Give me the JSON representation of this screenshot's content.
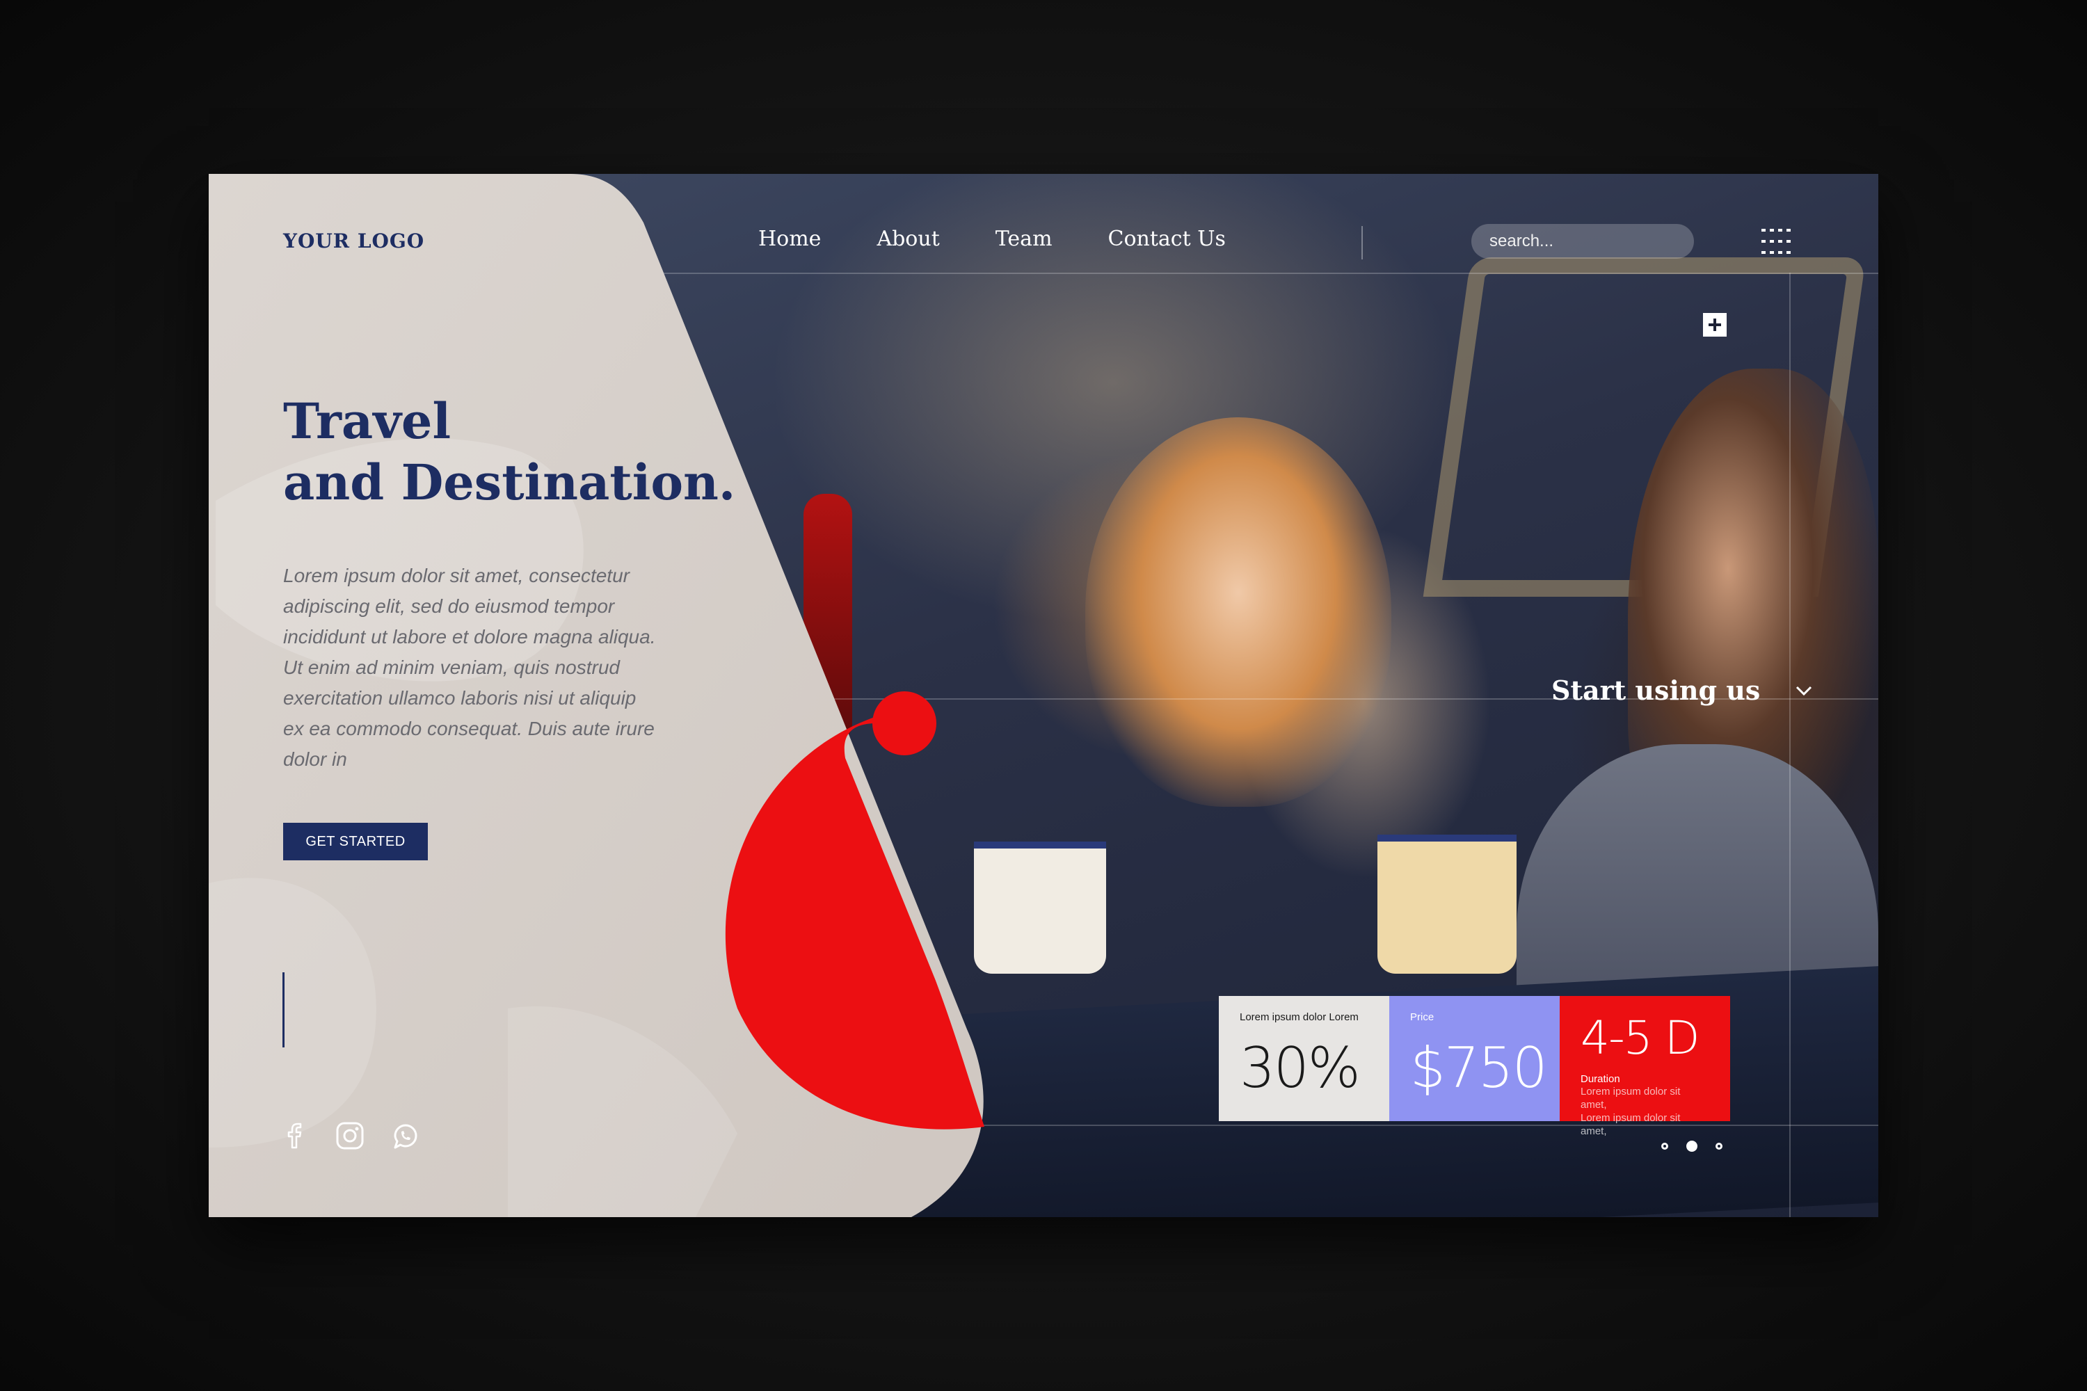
{
  "logo": "YOUR LOGO",
  "nav": {
    "items": [
      "Home",
      "About",
      "Team",
      "Contact Us"
    ]
  },
  "search": {
    "placeholder": "search..."
  },
  "hero": {
    "title_line1": "Travel",
    "title_line2": "and Destination.",
    "body": "Lorem ipsum dolor sit amet, consectetur adipiscing elit, sed do eiusmod tempor incididunt ut labore et dolore magna aliqua. Ut enim ad minim veniam, quis nostrud exercitation ullamco laboris nisi ut aliquip ex ea commodo consequat. Duis aute irure dolor in",
    "cta": "GET STARTED"
  },
  "start_using": "Start using us",
  "stats": {
    "card1": {
      "label": "Lorem ipsum dolor Lorem",
      "value": "30%"
    },
    "card2": {
      "label": "Price",
      "value": "$750"
    },
    "card3": {
      "value": "4-5 D",
      "label": "Duration",
      "line1": "Lorem ipsum dolor sit amet,",
      "line2": "Lorem ipsum dolor sit amet,"
    }
  },
  "social": [
    "facebook-icon",
    "instagram-icon",
    "whatsapp-icon"
  ],
  "slider": {
    "count": 3,
    "active_index": 1
  },
  "colors": {
    "navy": "#1d2d62",
    "beige": "#d6cfca",
    "red": "#ec0f12",
    "lavender": "#8f93f2",
    "light_gray": "#e7e5e3",
    "background": "#111111"
  }
}
